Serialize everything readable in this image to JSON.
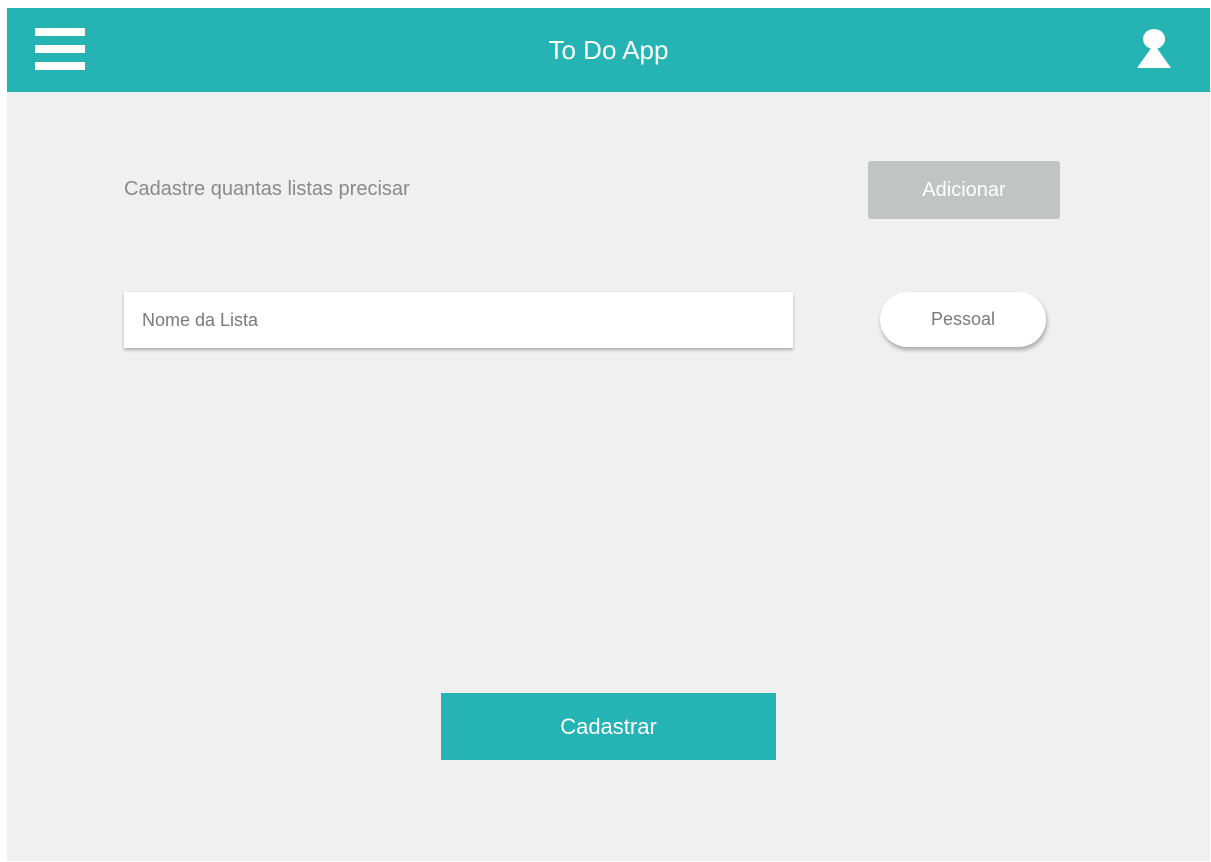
{
  "header": {
    "title": "To Do App",
    "menu_icon": "hamburger-menu-icon",
    "user_icon": "user-profile-icon",
    "background_color": "#26b3b3"
  },
  "form": {
    "intro_text": "Cadastre quantas listas precisar",
    "add_button_label": "Adicionar",
    "list_name_placeholder": "Nome da Lista",
    "list_name_value": "",
    "category_button_label": "Pessoal",
    "submit_button_label": "Cadastrar"
  },
  "colors": {
    "accent": "#26b3b3",
    "background": "#f0f0f0",
    "disabled_button": "#c2c3c3",
    "muted_text": "#8a8a8a"
  }
}
